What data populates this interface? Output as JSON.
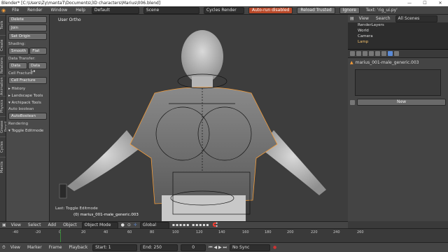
{
  "window": {
    "title": "Blender* [C:\\Users\\Zy\\mantaT\\Documents\\3D characters\\Marius\\006.blend]",
    "min": "—",
    "max": "☐",
    "close": "✕"
  },
  "info_header": {
    "menus": [
      "File",
      "Render",
      "Window",
      "Help"
    ],
    "layout": "Default",
    "scene": "Scene",
    "engine": "Cycles Render",
    "autorun": "Auto-run disabled",
    "reload": "Reload Trusted",
    "ignore": "Ignore",
    "text": "Text: 'rig_ui.py'"
  },
  "tool_tabs": [
    "Tools",
    "Create",
    "Relations",
    "Animation",
    "Physics",
    "Grease Pencil",
    "Cycles",
    "Mantis"
  ],
  "toolshelf": {
    "delete": "Delete",
    "join": "Join",
    "set_origin": "Set Origin",
    "shading_label": "Shading:",
    "smooth": "Smooth",
    "flat": "Flat",
    "data_transfer_label": "Data Transfer:",
    "data": "Data",
    "data_la": "Data La",
    "cell_fracture_label": "Cell Fracture",
    "cell_fracture_btn": "Cell Fracture",
    "history": "▸ History",
    "landscape": "▸ Landscape Tools",
    "archipack": "▾ Archipack Tools",
    "auto_boolean": "Auto boolean",
    "autoboolean_btn": "AutoBoolean",
    "rendering": "Rendering",
    "toggle_editmode": "▾ Toggle Editmode"
  },
  "viewport": {
    "view_label": "User Ortho",
    "last_op": "Last: Toggle Editmode",
    "object_label": "(0) marius_001-male_generic.003"
  },
  "view3d_header": {
    "menus": [
      "View",
      "Select",
      "Add",
      "Object"
    ],
    "mode": "Object Mode",
    "orientation": "Global"
  },
  "outliner": {
    "menus": [
      "View",
      "Search"
    ],
    "filter": "All Scenes",
    "items": [
      "RenderLayers",
      "World",
      "Camera",
      "Lamp"
    ]
  },
  "properties": {
    "object_name": "marius_001-male_generic.003",
    "new_button": "New"
  },
  "timeline": {
    "ticks": [
      "-40",
      "-20",
      "0",
      "20",
      "40",
      "60",
      "80",
      "100",
      "120",
      "140",
      "160",
      "180",
      "200",
      "220",
      "240",
      "260"
    ],
    "menus": [
      "View",
      "Marker",
      "Frame",
      "Playback"
    ],
    "start_label": "Start:",
    "start": "1",
    "end_label": "End:",
    "end": "250",
    "current": "0",
    "sync": "No Sync"
  },
  "colors": {
    "accent": "#f39c3a",
    "warn": "#ba4a2a",
    "selected": "#f3c06c"
  }
}
